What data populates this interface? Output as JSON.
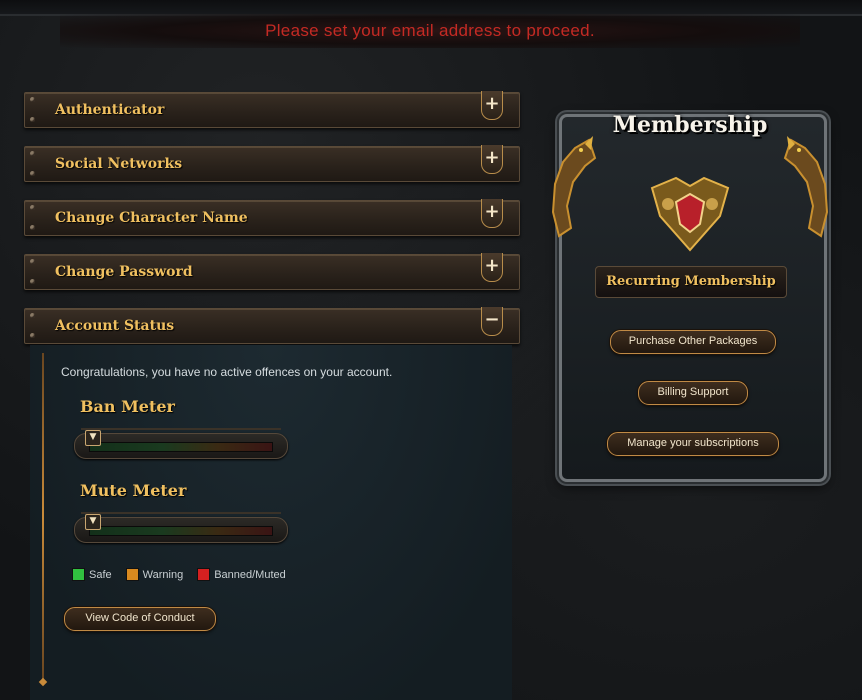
{
  "alert": {
    "text": "Please set your email address to proceed."
  },
  "accordion": [
    {
      "label": "Authenticator",
      "toggle": "+"
    },
    {
      "label": "Social Networks",
      "toggle": "+"
    },
    {
      "label": "Change Character Name",
      "toggle": "+"
    },
    {
      "label": "Change Password",
      "toggle": "+"
    },
    {
      "label": "Account Status",
      "toggle": "−"
    }
  ],
  "account_status": {
    "message": "Congratulations, you have no active offences on your account.",
    "ban_meter": {
      "title": "Ban Meter",
      "level": 0
    },
    "mute_meter": {
      "title": "Mute Meter",
      "level": 0
    },
    "legend": [
      {
        "label": "Safe",
        "color": "#31c040"
      },
      {
        "label": "Warning",
        "color": "#d98a1f"
      },
      {
        "label": "Banned/Muted",
        "color": "#d52020"
      }
    ],
    "conduct_button": "View Code of Conduct"
  },
  "membership": {
    "title": "Membership",
    "subtitle": "Recurring Membership",
    "buttons": [
      "Purchase Other Packages",
      "Billing Support",
      "Manage your subscriptions"
    ],
    "accent": "#b8202a"
  }
}
